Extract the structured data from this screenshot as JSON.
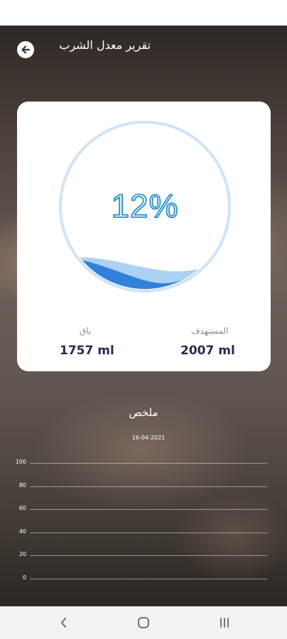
{
  "header": {
    "title": "تقرير معدل الشرب",
    "back_icon": "arrow-left-icon"
  },
  "progress": {
    "percent_text": "12%",
    "fill_fraction": 0.12,
    "accent": "#1a86c9",
    "ring": "#cfe3f7",
    "wave": "#2f7fd8"
  },
  "stats": {
    "remaining_label": "باق",
    "remaining_value": "1757 ml",
    "target_label": "المستهدف",
    "target_value": "2007 ml"
  },
  "summary": {
    "title": "ملخص",
    "date": "16-04-2021"
  },
  "chart_data": {
    "type": "bar",
    "categories": [],
    "values": [],
    "title": "",
    "xlabel": "",
    "ylabel": "",
    "ylim": [
      0,
      100
    ],
    "y_ticks": [
      "100",
      "80",
      "60",
      "40",
      "20",
      "0"
    ],
    "grid": true
  },
  "navbar": {
    "back_icon": "chevron-left-icon",
    "home_icon": "home-icon",
    "recents_icon": "recents-icon"
  }
}
